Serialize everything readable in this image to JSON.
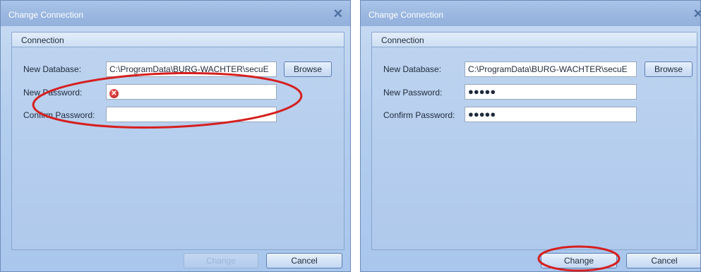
{
  "left_dialog": {
    "title": "Change Connection",
    "group_label": "Connection",
    "new_database_label": "New Database:",
    "new_database_value": "C:\\ProgramData\\BURG-WACHTER\\secuE",
    "browse_label": "Browse",
    "new_password_label": "New Password:",
    "confirm_password_label": "Confirm Password:",
    "change_label": "Change",
    "cancel_label": "Cancel",
    "change_enabled": false,
    "password_error_icon": "error-icon",
    "password_value": "",
    "confirm_value": ""
  },
  "right_dialog": {
    "title": "Change Connection",
    "group_label": "Connection",
    "new_database_label": "New Database:",
    "new_database_value": "C:\\ProgramData\\BURG-WACHTER\\secuE",
    "browse_label": "Browse",
    "new_password_label": "New Password:",
    "new_password_masked": "●●●●●",
    "confirm_password_label": "Confirm Password:",
    "confirm_password_masked": "●●●●●",
    "change_label": "Change",
    "cancel_label": "Cancel",
    "change_enabled": true
  },
  "colors": {
    "highlight_ring": "#d61f1f"
  }
}
